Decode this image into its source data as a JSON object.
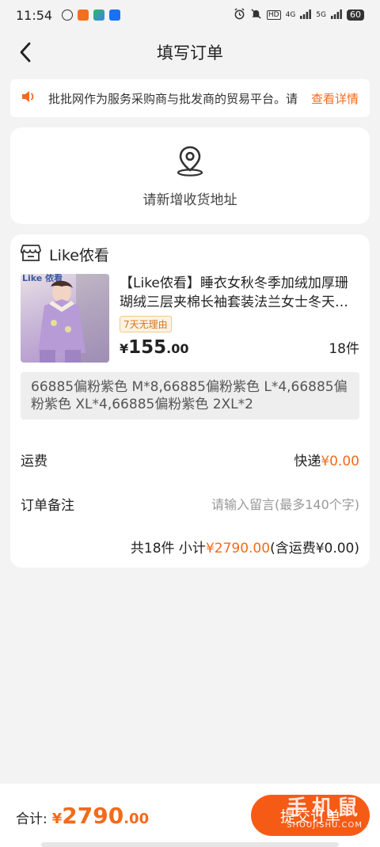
{
  "status_bar": {
    "time": "11:54",
    "signal_text": "4G",
    "signal_text2": "5G",
    "hd_label": "HD",
    "battery": "60"
  },
  "nav": {
    "title": "填写订单",
    "back_icon": "chevron-left-icon"
  },
  "notice": {
    "icon": "speaker-icon",
    "text": "批批网作为服务采购商与批发商的贸易平台。请",
    "link": "查看详情"
  },
  "address": {
    "icon": "location-pin-icon",
    "label": "请新增收货地址"
  },
  "order": {
    "shop_icon": "store-icon",
    "shop_name": "Like侬看",
    "product": {
      "image_brand": "Like 侬看",
      "title": "【Like侬看】睡衣女秋冬季加绒加厚珊瑚绒三层夹棉长袖套装法兰女士冬天…",
      "tag": "7天无理由",
      "price_currency": "¥",
      "price_int": "155",
      "price_dec": ".00",
      "quantity": "18件"
    },
    "specs": "66885偏粉紫色 M*8,66885偏粉紫色 L*4,66885偏粉紫色 XL*4,66885偏粉紫色 2XL*2",
    "shipping": {
      "label": "运费",
      "method": "快递",
      "amount": "¥0.00"
    },
    "note": {
      "label": "订单备注",
      "placeholder": "请输入留言(最多140个字)"
    },
    "subtotal": {
      "prefix": "共18件  小计",
      "amount": "¥2790.00",
      "suffix": "(含运费¥0.00)"
    }
  },
  "footer": {
    "total_label": "合计:",
    "total_currency": "¥",
    "total_int": "2790",
    "total_dec": ".00",
    "submit_label": "提交订单"
  },
  "watermark": {
    "cn": "手机鼠",
    "en": "SHOUJISHU.COM"
  },
  "colors": {
    "accent": "#f56a1a",
    "submit_bg": "#f65b16",
    "background": "#f3f3f3"
  }
}
